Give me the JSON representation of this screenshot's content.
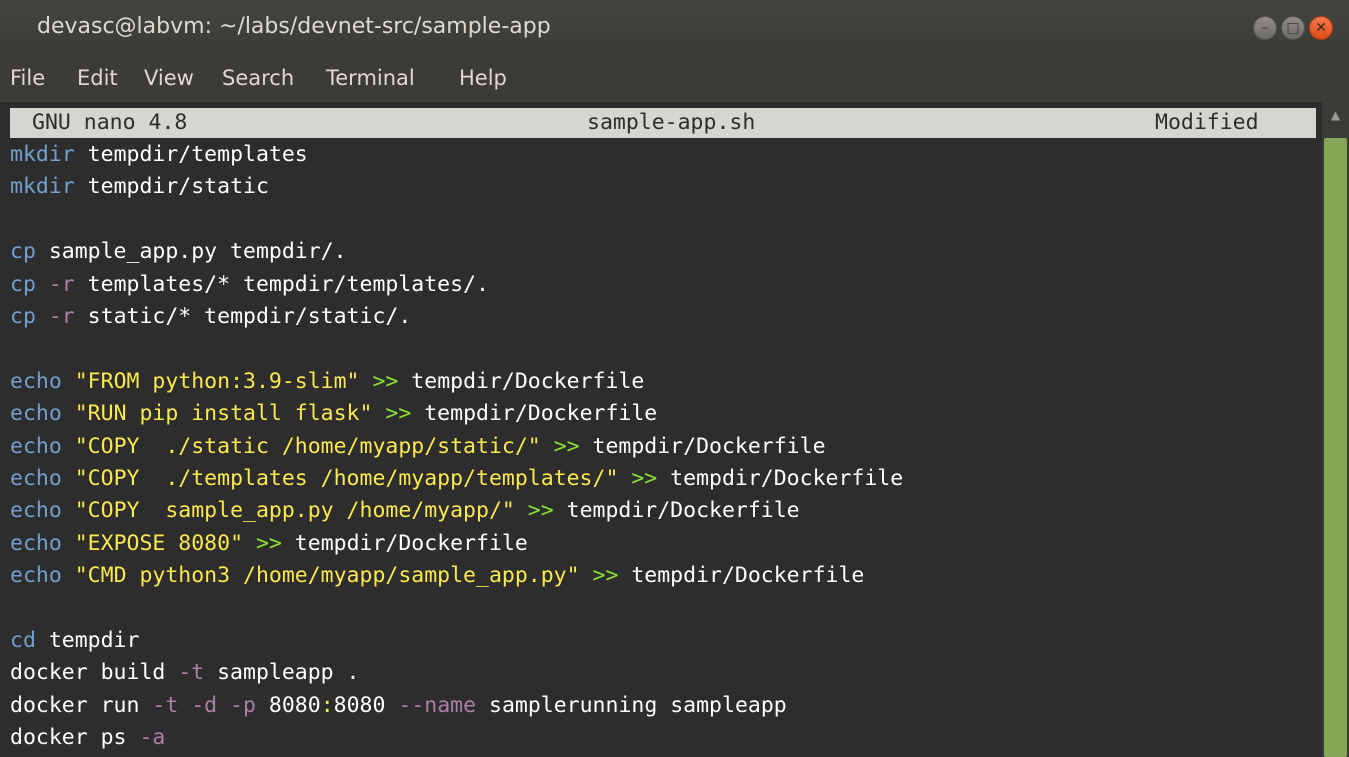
{
  "window": {
    "title": "devasc@labvm: ~/labs/devnet-src/sample-app",
    "controls": {
      "min": "–",
      "max": "□",
      "close": "✕"
    }
  },
  "menu": [
    "File",
    "Edit",
    "View",
    "Search",
    "Terminal",
    "Help"
  ],
  "nano": {
    "version": "GNU nano 4.8",
    "filename": "sample-app.sh",
    "status": "Modified"
  },
  "lines": [
    [
      {
        "t": "mkdir",
        "c": "cmd"
      },
      {
        "t": " tempdir/templates",
        "c": "txt"
      }
    ],
    [
      {
        "t": "mkdir",
        "c": "cmd"
      },
      {
        "t": " tempdir/static",
        "c": "txt"
      }
    ],
    [],
    [
      {
        "t": "cp",
        "c": "cmd"
      },
      {
        "t": " sample_app.py tempdir/.",
        "c": "txt"
      }
    ],
    [
      {
        "t": "cp",
        "c": "cmd"
      },
      {
        "t": " ",
        "c": "txt"
      },
      {
        "t": "-r",
        "c": "opt"
      },
      {
        "t": " templates/* tempdir/templates/.",
        "c": "txt"
      }
    ],
    [
      {
        "t": "cp",
        "c": "cmd"
      },
      {
        "t": " ",
        "c": "txt"
      },
      {
        "t": "-r",
        "c": "opt"
      },
      {
        "t": " static/* tempdir/static/.",
        "c": "txt"
      }
    ],
    [],
    [
      {
        "t": "echo",
        "c": "cmd"
      },
      {
        "t": " ",
        "c": "txt"
      },
      {
        "t": "\"FROM python:3.9-slim\"",
        "c": "str"
      },
      {
        "t": " ",
        "c": "txt"
      },
      {
        "t": ">>",
        "c": "red"
      },
      {
        "t": " tempdir/Dockerfile",
        "c": "txt"
      }
    ],
    [
      {
        "t": "echo",
        "c": "cmd"
      },
      {
        "t": " ",
        "c": "txt"
      },
      {
        "t": "\"RUN pip install flask\"",
        "c": "str"
      },
      {
        "t": " ",
        "c": "txt"
      },
      {
        "t": ">>",
        "c": "red"
      },
      {
        "t": " tempdir/Dockerfile",
        "c": "txt"
      }
    ],
    [
      {
        "t": "echo",
        "c": "cmd"
      },
      {
        "t": " ",
        "c": "txt"
      },
      {
        "t": "\"COPY  ./static /home/myapp/static/\"",
        "c": "str"
      },
      {
        "t": " ",
        "c": "txt"
      },
      {
        "t": ">>",
        "c": "red"
      },
      {
        "t": " tempdir/Dockerfile",
        "c": "txt"
      }
    ],
    [
      {
        "t": "echo",
        "c": "cmd"
      },
      {
        "t": " ",
        "c": "txt"
      },
      {
        "t": "\"COPY  ./templates /home/myapp/templates/\"",
        "c": "str"
      },
      {
        "t": " ",
        "c": "txt"
      },
      {
        "t": ">>",
        "c": "red"
      },
      {
        "t": " tempdir/Dockerfile",
        "c": "txt"
      }
    ],
    [
      {
        "t": "echo",
        "c": "cmd"
      },
      {
        "t": " ",
        "c": "txt"
      },
      {
        "t": "\"COPY  sample_app.py /home/myapp/\"",
        "c": "str"
      },
      {
        "t": " ",
        "c": "txt"
      },
      {
        "t": ">>",
        "c": "red"
      },
      {
        "t": " tempdir/Dockerfile",
        "c": "txt"
      }
    ],
    [
      {
        "t": "echo",
        "c": "cmd"
      },
      {
        "t": " ",
        "c": "txt"
      },
      {
        "t": "\"EXPOSE 8080\"",
        "c": "str"
      },
      {
        "t": " ",
        "c": "txt"
      },
      {
        "t": ">>",
        "c": "red"
      },
      {
        "t": " tempdir/Dockerfile",
        "c": "txt"
      }
    ],
    [
      {
        "t": "echo",
        "c": "cmd"
      },
      {
        "t": " ",
        "c": "txt"
      },
      {
        "t": "\"CMD python3 /home/myapp/sample_app.py\"",
        "c": "str"
      },
      {
        "t": " ",
        "c": "txt"
      },
      {
        "t": ">>",
        "c": "red"
      },
      {
        "t": " tempdir/Dockerfile",
        "c": "txt"
      }
    ],
    [],
    [
      {
        "t": "cd",
        "c": "cmd"
      },
      {
        "t": " tempdir",
        "c": "txt"
      }
    ],
    [
      {
        "t": "docker build ",
        "c": "txt"
      },
      {
        "t": "-t",
        "c": "opt"
      },
      {
        "t": " sampleapp .",
        "c": "txt"
      }
    ],
    [
      {
        "t": "docker run ",
        "c": "txt"
      },
      {
        "t": "-t",
        "c": "opt"
      },
      {
        "t": " ",
        "c": "txt"
      },
      {
        "t": "-d",
        "c": "opt"
      },
      {
        "t": " ",
        "c": "txt"
      },
      {
        "t": "-p",
        "c": "opt"
      },
      {
        "t": " 8080",
        "c": "txt"
      },
      {
        "t": ":",
        "c": "num"
      },
      {
        "t": "8080 ",
        "c": "txt"
      },
      {
        "t": "--name",
        "c": "opt"
      },
      {
        "t": " samplerunning sampleapp",
        "c": "txt"
      }
    ],
    [
      {
        "t": "docker ps ",
        "c": "txt"
      },
      {
        "t": "-a",
        "c": "opt"
      }
    ]
  ]
}
